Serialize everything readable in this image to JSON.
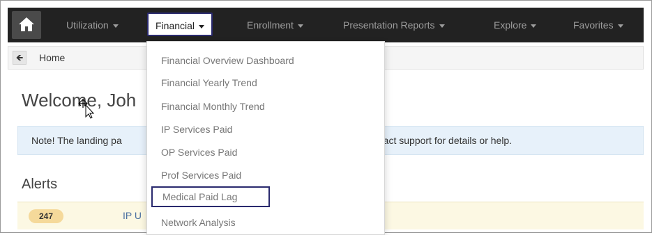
{
  "nav": {
    "items": [
      {
        "label": "Utilization"
      },
      {
        "label": "Financial"
      },
      {
        "label": "Enrollment"
      },
      {
        "label": "Presentation Reports"
      },
      {
        "label": "Explore"
      },
      {
        "label": "Favorites"
      }
    ]
  },
  "breadcrumb": {
    "home_label": "Home",
    "back_icon": "arrow-left-icon"
  },
  "welcome": {
    "text": "Welcome, Joh"
  },
  "note": {
    "left_text": "Note! The landing pa",
    "right_text": "ntact support for details or help."
  },
  "alerts": {
    "title": "Alerts",
    "rows": [
      {
        "count": "247",
        "text": "IP U"
      }
    ]
  },
  "financial_menu": {
    "items": [
      {
        "label": "Financial Overview Dashboard"
      },
      {
        "label": "Financial Yearly Trend"
      },
      {
        "label": "Financial Monthly Trend"
      },
      {
        "label": "IP Services Paid"
      },
      {
        "label": "OP Services Paid"
      },
      {
        "label": "Prof Services Paid"
      },
      {
        "label": "Medical Paid Lag"
      },
      {
        "label": "Network Analysis"
      }
    ]
  },
  "colors": {
    "navbar": "#222222",
    "highlight_border": "#2a2a6e",
    "note_bg": "#e7f1fa",
    "alert_bg": "#fcf8e3"
  }
}
